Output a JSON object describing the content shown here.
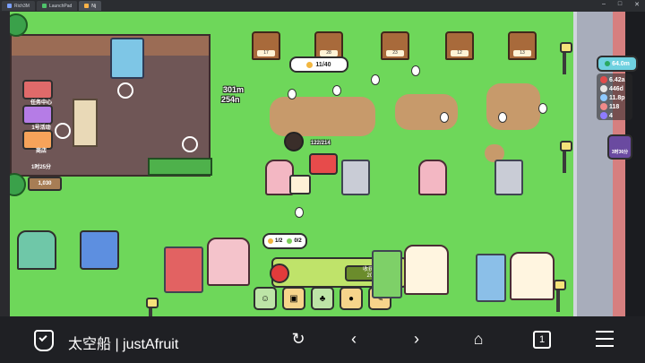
{
  "browser": {
    "tabs": [
      {
        "label": "Rich3M"
      },
      {
        "label": "LaunchPad"
      },
      {
        "label": "Nj"
      }
    ],
    "window_controls": [
      "–",
      "□",
      "✕"
    ]
  },
  "game": {
    "harvest_counter": {
      "count": "11/40"
    },
    "float_texts": [
      "301m",
      "254n"
    ],
    "player_counter": "122/214",
    "inventory": {
      "slot1": "1/2",
      "slot2": "0/2"
    },
    "collect_panel": {
      "label": "收获完成",
      "progress": "20/20"
    },
    "left_hud": {
      "task_label": "任务中心",
      "event_label": "1号活动",
      "shop_label": "商店",
      "timer": "1时25分",
      "price": "1,030"
    },
    "stall_labels": [
      "17",
      "28",
      "23",
      "12",
      "13"
    ],
    "right_hud": {
      "gem": "64.0m",
      "stats": [
        {
          "value": "6.42a",
          "color": "#e04b4b"
        },
        {
          "value": "446d",
          "color": "#e6e6e6"
        },
        {
          "value": "11.8p",
          "color": "#8ec9ff"
        },
        {
          "value": "118",
          "color": "#f08a8a"
        },
        {
          "value": "4",
          "color": "#8e7cff"
        }
      ],
      "event_timer": "3时36分"
    }
  },
  "nav": {
    "title": "太空船 | justAfruit",
    "tab_count": "1",
    "icons": [
      "shield-check-icon",
      "refresh-icon",
      "back-icon",
      "forward-icon",
      "home-icon",
      "tabs-icon",
      "menu-icon"
    ]
  }
}
